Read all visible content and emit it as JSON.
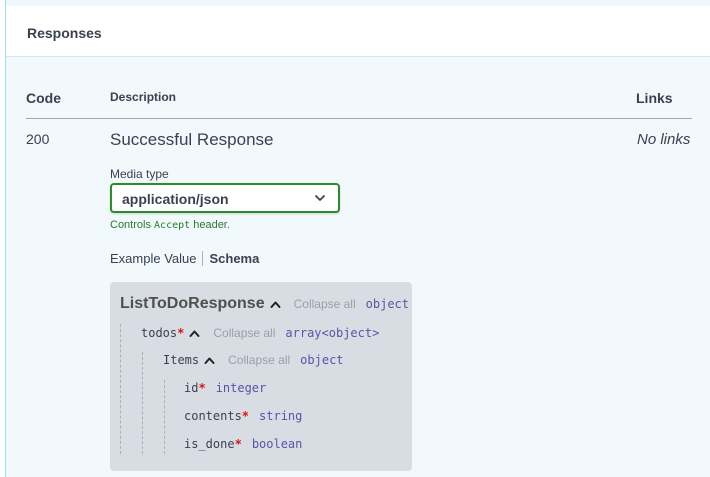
{
  "responses_title": "Responses",
  "columns": {
    "code": "Code",
    "description": "Description",
    "links": "Links"
  },
  "response": {
    "code": "200",
    "description": "Successful Response",
    "links": "No links",
    "media_type_label": "Media type",
    "media_type_value": "application/json",
    "controls_prefix": "Controls",
    "controls_code": "Accept",
    "controls_suffix": "header."
  },
  "tabs": {
    "example": "Example Value",
    "schema": "Schema",
    "active": "schema"
  },
  "schema": {
    "model_name": "ListToDoResponse",
    "collapse_all": "Collapse all",
    "model_type": "object",
    "todos": {
      "name": "todos",
      "type": "array<object>"
    },
    "items": {
      "name": "Items",
      "type": "object"
    },
    "fields": [
      {
        "name": "id",
        "required": "*",
        "type": "integer"
      },
      {
        "name": "contents",
        "required": "*",
        "type": "string"
      },
      {
        "name": "is_done",
        "required": "*",
        "type": "boolean"
      }
    ],
    "required_mark": "*"
  },
  "colors": {
    "accent_green": "#2b8c2b",
    "type_blue": "#5555aa",
    "required_red": "#e01010",
    "schema_bg": "#d8dde3"
  }
}
